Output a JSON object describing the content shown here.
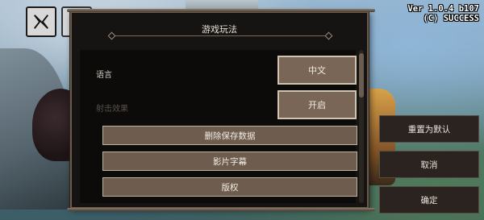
{
  "version": {
    "line1": "Ver 1.0.4 b107",
    "line2": "(C) SUCCESS"
  },
  "panel": {
    "title": "游戏玩法"
  },
  "settings": [
    {
      "label": "语言",
      "value": "中文",
      "enabled": true
    },
    {
      "label": "射击效果",
      "value": "开启",
      "enabled": false
    }
  ],
  "actions": {
    "delete_save": "删除保存数据",
    "subtitles": "影片字幕",
    "copyright": "版权"
  },
  "side": {
    "reset": "重置为默认",
    "cancel": "取消",
    "confirm": "确定"
  },
  "icons": {
    "top_left": "x-logo-icon",
    "second": "settings-icon"
  }
}
